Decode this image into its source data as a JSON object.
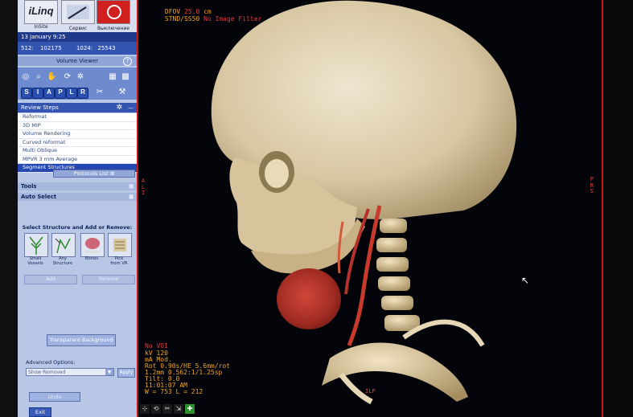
{
  "app": {
    "brand": "iLinq",
    "brand_caption": "InSite",
    "tools": [
      {
        "label": "Сервис",
        "icon": "service-icon"
      },
      {
        "label": "Выключение",
        "icon": "power-icon"
      }
    ],
    "date_time": "13 January  9:25",
    "mem_left_label": "512:",
    "mem_left_value": "102175",
    "mem_right_label": "1024:",
    "mem_right_value": "25543",
    "panel_title": "Volume Viewer",
    "help_label": "?"
  },
  "toolbar": {
    "row1": [
      "adjust-icon",
      "zoom-icon",
      "pan-icon",
      "rotate-icon",
      "window-level-icon",
      "layout-icon-1",
      "layout-icon-2"
    ],
    "row2": [
      "S",
      "I",
      "A",
      "P",
      "L",
      "R"
    ],
    "row2_extra": [
      "slice-icon",
      "cut-icon"
    ]
  },
  "review": {
    "title": "Review Steps",
    "items": [
      "Reformat",
      "3D MIP",
      "Volume Rendering",
      "Curved reformat",
      "Multi Oblique",
      "MPVR 3 mm Average",
      "Segment Structures"
    ],
    "selected_index": 6,
    "protocols_label": "Protocols List"
  },
  "sections": {
    "tools": "Tools",
    "auto_select": "Auto Select"
  },
  "auto_select": {
    "title": "Select Structure and Add or Remove:",
    "structures": [
      {
        "label": "Small\nVessels"
      },
      {
        "label": "Any\nStructure"
      },
      {
        "label": "Bones"
      },
      {
        "label": "Pick\nfrom VR"
      }
    ],
    "add_label": "Add",
    "remove_label": "Remove",
    "transparent_bg": "Transparent Background",
    "advanced_label": "Advanced Options:",
    "dropdown_value": "Show Removed",
    "apply_label": "Apply",
    "undo_label": "Undo",
    "exit_label": "Exit"
  },
  "viewer": {
    "top_overlay_1": "DFOV ",
    "top_overlay_1_value": "25.0",
    "top_overlay_1_unit": " cm",
    "top_overlay_2": "STND/SS50 ",
    "top_overlay_2_value": "No Image Filter",
    "left_orient": "A\nL\nI",
    "right_orient": "P\nR\nS",
    "bottom_orient": "ILP",
    "bottom_overlay_1": "No VOI",
    "bottom_overlay_lines": [
      "kV 120",
      "mA Mod.",
      "Rot 0.90s/HE 5.6mm/rot",
      "1.2mm 0.562:1/1.25sp",
      "Tilt: 0.0",
      "11:01:07 AM",
      "W = 753 L = 212"
    ],
    "tools": [
      "cursor-icon",
      "rotate-view-icon",
      "scissors-icon",
      "export-icon",
      "crosshair-icon"
    ]
  },
  "colors": {
    "panel_bg": "#b8c7e6",
    "panel_dark": "#1f3a8a",
    "accent_red": "#c41616",
    "overlay_orange": "#f0a41e",
    "overlay_red": "#e33b3b"
  }
}
